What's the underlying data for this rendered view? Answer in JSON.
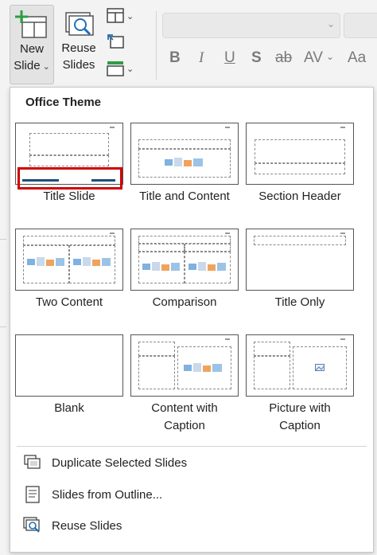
{
  "ribbon": {
    "new_slide": {
      "line1": "New",
      "line2": "Slide"
    },
    "reuse_slides": {
      "line1": "Reuse",
      "line2": "Slides"
    },
    "icons": [
      "new-slide-icon",
      "reuse-slides-icon",
      "layout-icon",
      "reset-icon",
      "section-icon"
    ],
    "format_buttons": [
      "B",
      "I",
      "U",
      "S",
      "ab",
      "AV",
      "Aa"
    ]
  },
  "panel": {
    "section_title": "Office Theme",
    "layouts": [
      {
        "label": "Title Slide"
      },
      {
        "label": "Title and Content"
      },
      {
        "label": "Section Header"
      },
      {
        "label": "Two Content"
      },
      {
        "label": "Comparison"
      },
      {
        "label": "Title Only"
      },
      {
        "label": "Blank"
      },
      {
        "label_line1": "Content with",
        "label_line2": "Caption"
      },
      {
        "label_line1": "Picture with",
        "label_line2": "Caption"
      }
    ],
    "menu": [
      {
        "label": "Duplicate Selected Slides",
        "icon": "duplicate-icon"
      },
      {
        "label": "Slides from Outline...",
        "icon": "outline-icon"
      },
      {
        "label": "Reuse Slides",
        "icon": "reuse-slides-icon"
      }
    ]
  },
  "colors": {
    "highlight": "#d00000",
    "accent": "#1f4e79",
    "green": "#2e9e44"
  }
}
